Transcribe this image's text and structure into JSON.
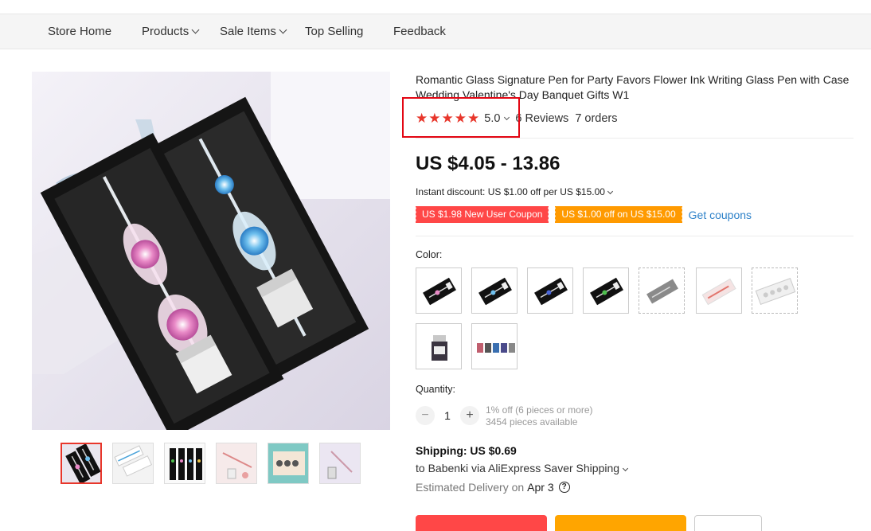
{
  "nav": {
    "items": [
      {
        "label": "Store Home",
        "dropdown": false
      },
      {
        "label": "Products",
        "dropdown": true
      },
      {
        "label": "Sale Items",
        "dropdown": true
      },
      {
        "label": "Top Selling",
        "dropdown": false
      },
      {
        "label": "Feedback",
        "dropdown": false
      }
    ]
  },
  "product": {
    "title": "Romantic Glass Signature Pen for Party Favors Flower Ink Writing Glass Pen with Case Wedding Valentine's Day Banquet Gifts W1",
    "rating": "5.0",
    "stars": 5,
    "reviews": "6 Reviews",
    "orders": "7 orders",
    "price": "US $4.05 - 13.86",
    "instant_discount": "Instant discount: US $1.00 off per US $15.00",
    "coupons": [
      {
        "label": "US $1.98 New User Coupon",
        "color": "#ff4747"
      },
      {
        "label": "US $1.00 off on US $15.00",
        "color": "#ff9a00"
      }
    ],
    "get_coupons": "Get coupons",
    "color_label": "Color:",
    "quantity_label": "Quantity:",
    "quantity": "1",
    "quantity_minus": "−",
    "quantity_plus": "+",
    "quantity_discount": "1% off (6 pieces or more)",
    "available": "3454 pieces available"
  },
  "shipping": {
    "cost": "Shipping: US $0.69",
    "to": "to Babenki via AliExpress Saver Shipping",
    "delivery_label": "Estimated Delivery on",
    "delivery_date": "Apr 3",
    "help_symbol": "?"
  },
  "colors": {
    "accent_red": "#ff4747",
    "accent_orange": "#ff9a00",
    "link_blue": "#2e82c9",
    "highlight_box": "#e30613",
    "star": "#e8362b"
  }
}
